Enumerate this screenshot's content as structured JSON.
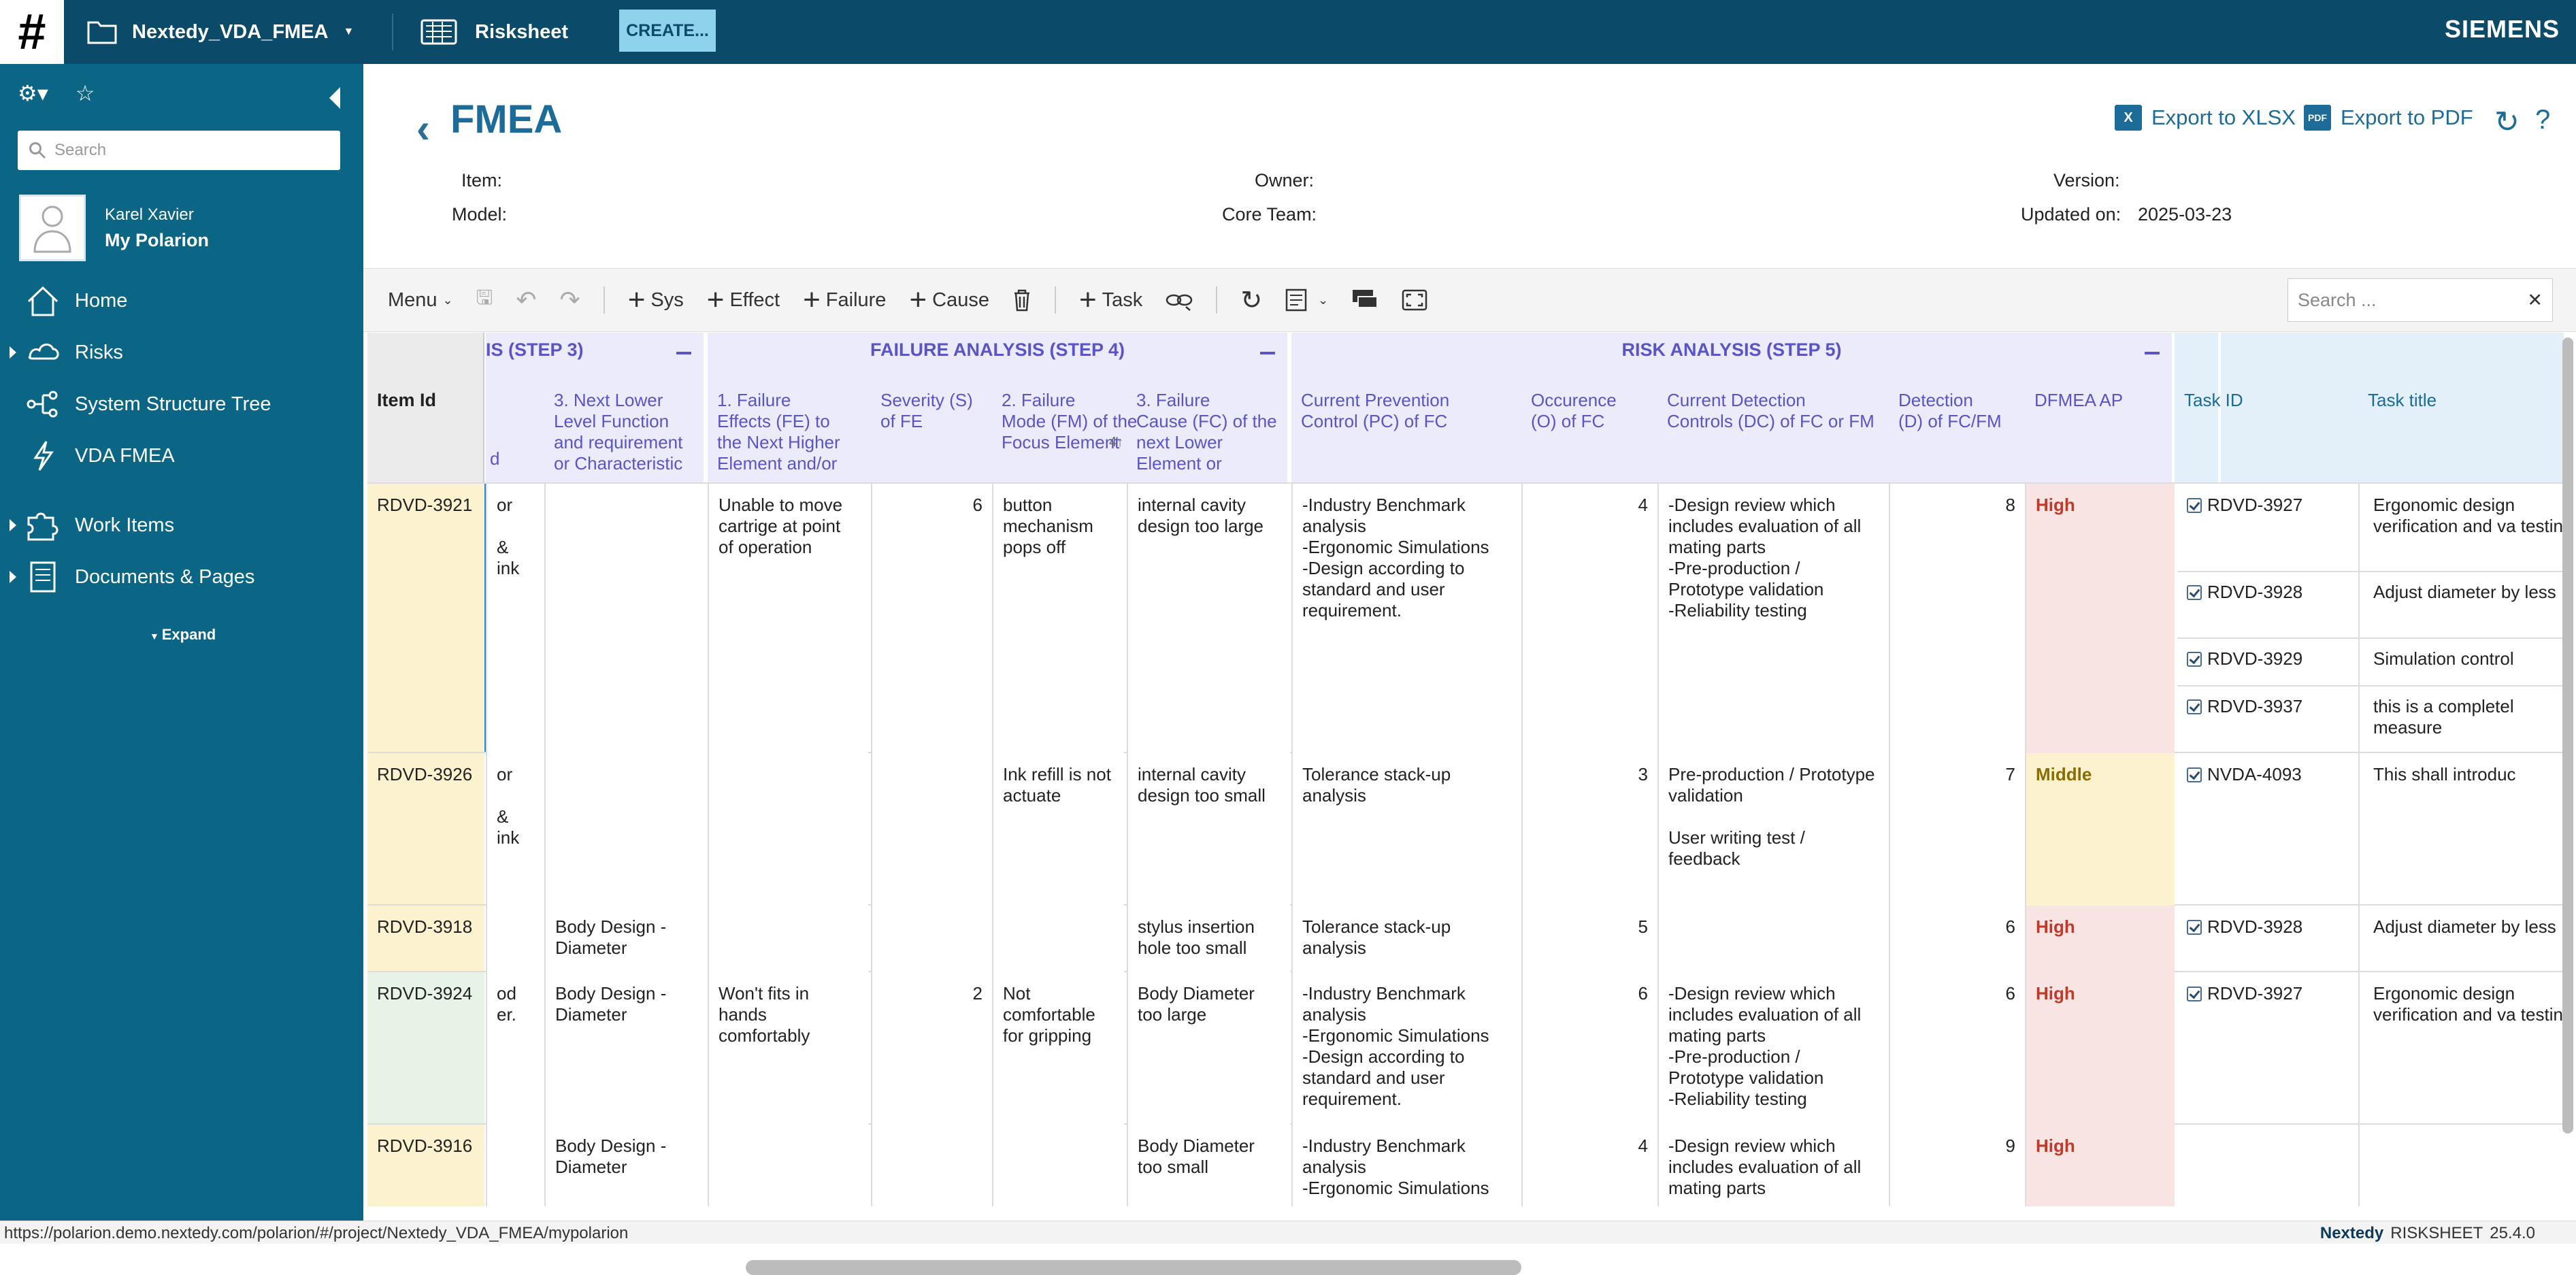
{
  "topbar": {
    "project": "Nextedy_VDA_FMEA",
    "app": "Risksheet",
    "create": "CREATE...",
    "brand": "SIEMENS"
  },
  "sidebar": {
    "search_placeholder": "Search",
    "user": {
      "name": "Karel Xavier",
      "link": "My Polarion"
    },
    "nav": [
      {
        "label": "Home",
        "icon": "home-icon",
        "expandable": false
      },
      {
        "label": "Risks",
        "icon": "risks-icon",
        "expandable": true
      },
      {
        "label": "System Structure Tree",
        "icon": "tree-icon",
        "expandable": false
      },
      {
        "label": "VDA FMEA",
        "icon": "lightning-icon",
        "expandable": false
      },
      {
        "label": "Work Items",
        "icon": "puzzle-icon",
        "expandable": true
      },
      {
        "label": "Documents & Pages",
        "icon": "document-icon",
        "expandable": true
      }
    ],
    "expand": "Expand"
  },
  "page": {
    "title": "FMEA",
    "meta": {
      "item_label": "Item:",
      "model_label": "Model:",
      "owner_label": "Owner:",
      "core_team_label": "Core Team:",
      "version_label": "Version:",
      "updated_label": "Updated on:",
      "updated_value": "2025-03-23"
    },
    "actions": {
      "export_xlsx": "Export to XLSX",
      "export_pdf": "Export to PDF"
    }
  },
  "toolbar": {
    "menu": "Menu",
    "sys": "Sys",
    "effect": "Effect",
    "failure": "Failure",
    "cause": "Cause",
    "task": "Task",
    "search_placeholder": "Search ..."
  },
  "grid": {
    "id_header": "Item Id",
    "groups": {
      "step3": "IS (STEP 3)",
      "step4": "FAILURE ANALYSIS (STEP 4)",
      "step5": "RISK ANALYSIS (STEP 5)"
    },
    "columns": {
      "c_partial": "d",
      "next_lower": "3. Next Lower\nLevel Function\nand requirement\nor Characteristic",
      "fe": "1. Failure\nEffects (FE) to\nthe Next Higher\nElement and/or",
      "sev": "Severity (S)\nof FE",
      "fm": "2. Failure\nMode (FM) of the\nFocus Element",
      "fc": "3. Failure\nCause (FC) of the\nnext Lower\nElement or",
      "pc": "Current Prevention\nControl (PC) of FC",
      "occ": "Occurence\n(O) of FC",
      "dc": "Current Detection\nControls (DC) of FC or FM",
      "det": "Detection\n(D) of FC/FM",
      "ap": "DFMEA AP",
      "task_id": "Task ID",
      "task_title": "Task title",
      "sort_badge": "4↑"
    },
    "rows": [
      {
        "id": "RDVD-3921",
        "c_partial": "or\n\n& ink",
        "next_lower": "",
        "fe": "Unable to move cartrige  at point of operation",
        "sev": "6",
        "fm": "button mechanism pops off",
        "fc": "internal cavity design too large",
        "pc": "-Industry Benchmark analysis\n-Ergonomic Simulations\n-Design according to standard and user requirement.",
        "occ": "4",
        "dc": "-Design review which includes evaluation of all mating parts\n-Pre-production / Prototype validation\n-Reliability testing",
        "det": "8",
        "ap": "High",
        "tasks": [
          {
            "id": "RDVD-3927",
            "title": "Ergonomic design verification and va testing"
          },
          {
            "id": "RDVD-3928",
            "title": "Adjust diameter by less"
          },
          {
            "id": "RDVD-3929",
            "title": "Simulation control"
          },
          {
            "id": "RDVD-3937",
            "title": "this is a completel measure"
          }
        ]
      },
      {
        "id": "RDVD-3926",
        "c_partial": "or\n\n& ink",
        "next_lower": "",
        "fe": "",
        "sev": "",
        "fm": "Ink refill is not actuate",
        "fc": "internal cavity design too small",
        "pc": "Tolerance stack-up analysis",
        "occ": "3",
        "dc": "Pre-production / Prototype validation\n\nUser writing test / feedback",
        "det": "7",
        "ap": "Middle",
        "tasks": [
          {
            "id": "NVDA-4093",
            "title": "This shall introduc"
          }
        ]
      },
      {
        "id": "RDVD-3918",
        "c_partial": "",
        "next_lower": "Body Design - Diameter",
        "fe": "",
        "sev": "",
        "fm": "",
        "fc": "stylus insertion hole too small",
        "pc": "Tolerance stack-up analysis",
        "occ": "5",
        "dc": "",
        "det": "6",
        "ap": "High",
        "tasks": [
          {
            "id": "RDVD-3928",
            "title": "Adjust diameter by less"
          }
        ]
      },
      {
        "id": "RDVD-3924",
        "c_partial": "od\ner.",
        "next_lower": "Body Design - Diameter",
        "fe": "Won't fits in hands comfortably",
        "sev": "2",
        "fm": "Not comfortable for gripping",
        "fc": "Body Diameter too large",
        "pc": "-Industry Benchmark analysis\n-Ergonomic Simulations\n-Design according to standard and user requirement.",
        "occ": "6",
        "dc": "-Design review which includes evaluation of all mating parts\n-Pre-production / Prototype validation\n-Reliability testing",
        "det": "6",
        "ap": "High",
        "tasks": [
          {
            "id": "RDVD-3927",
            "title": "Ergonomic design verification and va testing"
          }
        ]
      },
      {
        "id": "RDVD-3916",
        "c_partial": "",
        "next_lower": "Body Design - Diameter",
        "fe": "",
        "sev": "",
        "fm": "",
        "fc": "Body Diameter too small",
        "pc": "-Industry Benchmark analysis\n-Ergonomic Simulations",
        "occ": "4",
        "dc": "-Design review which includes evaluation of all mating parts",
        "det": "9",
        "ap": "High",
        "tasks": []
      }
    ]
  },
  "status": {
    "url": "https://polarion.demo.nextedy.com/polarion/#/project/Nextedy_VDA_FMEA/mypolarion",
    "brand": "Nextedy",
    "product": "RISKSHEET",
    "version": "25.4.0"
  },
  "colors": {
    "topbar": "#0c4a6a",
    "sidebar": "#0b6585",
    "accent": "#1d6b98",
    "group_header": "#ecebfb",
    "ap_high_bg": "#f8e5e3",
    "ap_mid_bg": "#fdf2cf"
  }
}
